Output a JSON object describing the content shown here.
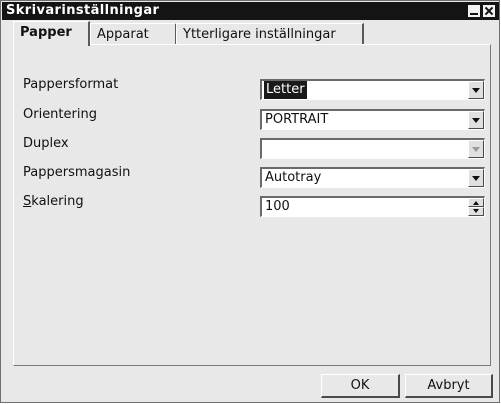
{
  "window": {
    "title": "Skrivarinställningar"
  },
  "tabs": [
    {
      "label": "Papper",
      "active": true
    },
    {
      "label": "Apparat",
      "active": false
    },
    {
      "label": "Ytterligare inställningar",
      "active": false
    }
  ],
  "fields": {
    "paper_format": {
      "label": "Pappersformat",
      "value": "Letter"
    },
    "orientation": {
      "label": "Orientering",
      "value": "PORTRAIT"
    },
    "duplex": {
      "label": "Duplex",
      "value": ""
    },
    "paper_tray": {
      "label": "Pappersmagasin",
      "value": "Autotray"
    },
    "scaling": {
      "label_mnemonic": "S",
      "label_rest": "kalering",
      "value": "100"
    }
  },
  "buttons": {
    "ok": "OK",
    "cancel": "Avbryt"
  }
}
